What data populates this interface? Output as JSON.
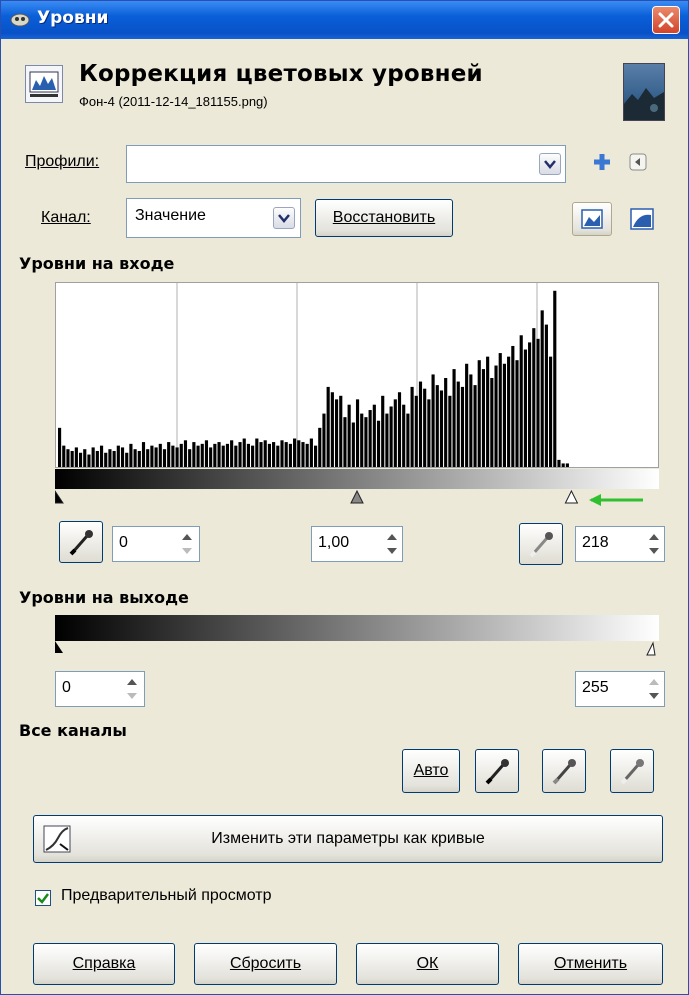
{
  "window": {
    "title": "Уровни"
  },
  "header": {
    "title": "Коррекция цветовых уровней",
    "subtitle": "Фон-4 (2011-12-14_181155.png)"
  },
  "profiles": {
    "label": "Профили:",
    "value": ""
  },
  "channel": {
    "label": "Канал:",
    "value": "Значение",
    "reset_button": "Восстановить"
  },
  "input_levels": {
    "heading": "Уровни на входе",
    "low": "0",
    "gamma": "1,00",
    "high": "218",
    "histogram": [
      0.22,
      0.12,
      0.1,
      0.09,
      0.11,
      0.08,
      0.1,
      0.07,
      0.11,
      0.09,
      0.12,
      0.08,
      0.1,
      0.09,
      0.12,
      0.11,
      0.08,
      0.13,
      0.1,
      0.09,
      0.14,
      0.1,
      0.12,
      0.11,
      0.13,
      0.1,
      0.14,
      0.12,
      0.11,
      0.13,
      0.15,
      0.1,
      0.14,
      0.12,
      0.13,
      0.15,
      0.11,
      0.13,
      0.14,
      0.12,
      0.13,
      0.15,
      0.12,
      0.14,
      0.16,
      0.13,
      0.12,
      0.16,
      0.14,
      0.15,
      0.13,
      0.14,
      0.12,
      0.15,
      0.14,
      0.13,
      0.16,
      0.15,
      0.14,
      0.13,
      0.16,
      0.12,
      0.22,
      0.3,
      0.45,
      0.42,
      0.38,
      0.4,
      0.28,
      0.35,
      0.25,
      0.38,
      0.3,
      0.28,
      0.32,
      0.35,
      0.26,
      0.4,
      0.3,
      0.34,
      0.38,
      0.42,
      0.35,
      0.3,
      0.45,
      0.4,
      0.48,
      0.44,
      0.38,
      0.52,
      0.46,
      0.43,
      0.5,
      0.4,
      0.55,
      0.48,
      0.45,
      0.58,
      0.52,
      0.46,
      0.6,
      0.55,
      0.62,
      0.5,
      0.57,
      0.64,
      0.58,
      0.62,
      0.68,
      0.6,
      0.74,
      0.66,
      0.7,
      0.78,
      0.72,
      0.88,
      0.8,
      0.62,
      0.99,
      0.04,
      0.02,
      0.02
    ],
    "marker_positions": [
      0,
      0.5,
      0.855
    ]
  },
  "output_levels": {
    "heading": "Уровни на выходе",
    "low": "0",
    "high": "255"
  },
  "all_channels": {
    "heading": "Все каналы",
    "auto_button": "Авто"
  },
  "curves_button": "Изменить эти параметры как кривые",
  "preview": {
    "label": "Предварительный просмотр",
    "checked": true
  },
  "footer": {
    "help": "Справка",
    "reset": "Сбросить",
    "ok": "ОК",
    "cancel": "Отменить"
  },
  "colors": {
    "titlebar": "#0a5fd8",
    "arrow": "#2fbf2f",
    "dialog_bg": "#ece9d8"
  }
}
